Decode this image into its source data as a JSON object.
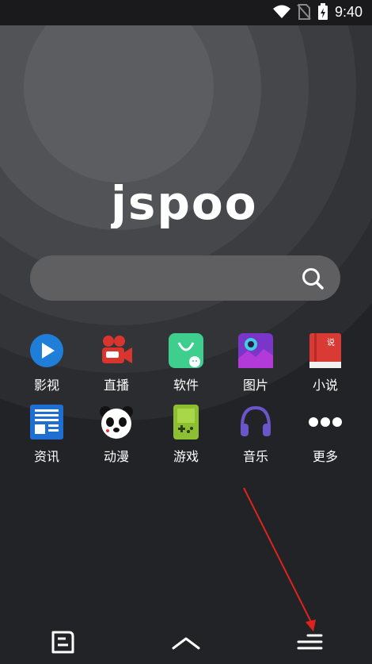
{
  "status_bar": {
    "time": "9:40"
  },
  "logo": {
    "text": "jspoo"
  },
  "search": {
    "placeholder": ""
  },
  "apps": [
    {
      "label": "影视",
      "icon": "video-play-icon"
    },
    {
      "label": "直播",
      "icon": "live-camera-icon"
    },
    {
      "label": "软件",
      "icon": "software-bag-icon"
    },
    {
      "label": "图片",
      "icon": "picture-icon"
    },
    {
      "label": "小说",
      "icon": "novel-book-icon"
    },
    {
      "label": "资讯",
      "icon": "news-icon"
    },
    {
      "label": "动漫",
      "icon": "anime-panda-icon"
    },
    {
      "label": "游戏",
      "icon": "gamepad-icon"
    },
    {
      "label": "音乐",
      "icon": "headphones-icon"
    },
    {
      "label": "更多",
      "icon": "more-dots-icon"
    }
  ],
  "novel_badge": "说",
  "colors": {
    "background": "#222327",
    "accent_arrow": "#e0221c"
  }
}
